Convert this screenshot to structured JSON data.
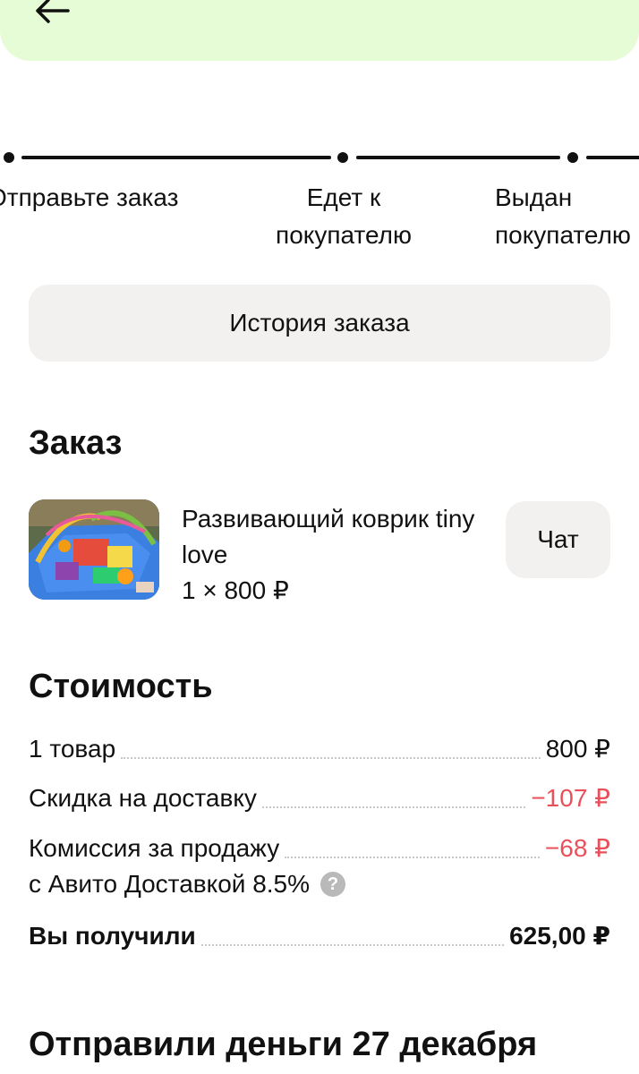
{
  "header": {
    "back_icon": "arrow-left-icon",
    "banner_color": "#e6fcd6"
  },
  "tracker": {
    "steps": [
      {
        "label": "Отправьте заказ"
      },
      {
        "label": "Едет к\nпокупателю"
      },
      {
        "label": "Выдан\nпокупателю"
      }
    ]
  },
  "history_button": {
    "label": "История заказа"
  },
  "order": {
    "heading": "Заказ",
    "item_title": "Развивающий коврик tiny love",
    "item_qty": "1 × 800 ₽",
    "chat_label": "Чат"
  },
  "cost": {
    "heading": "Стоимость",
    "rows": [
      {
        "label": "1 товар",
        "value": "800 ₽"
      },
      {
        "label": "Скидка на доставку",
        "value": "−107 ₽"
      },
      {
        "label": "Комиссия за продажу",
        "label_line2": "с Авито Доставкой 8.5%",
        "value": "−68 ₽"
      }
    ],
    "total_label": "Вы получили",
    "total_value": "625,00 ₽",
    "negative_color": "#e8505b"
  },
  "payout": {
    "heading": "Отправили деньги 27 декабря"
  }
}
